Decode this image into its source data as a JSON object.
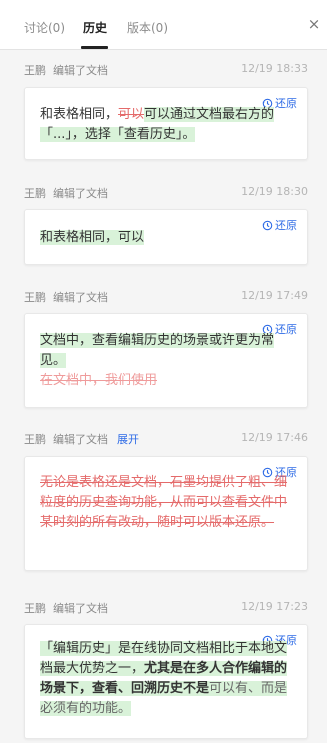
{
  "tabs": [
    {
      "label": "讨论(0)"
    },
    {
      "label": "历史"
    },
    {
      "label": "版本(0)"
    }
  ],
  "close_icon": "×",
  "restore_label": "还原",
  "entries": [
    {
      "author": "王鹏",
      "action": "编辑了文档",
      "time": "12/19 18:33",
      "segs": [
        "和表格相同，",
        "可以",
        "可以通过文档最右方的「...」，选择「查看历史」。"
      ]
    },
    {
      "author": "王鹏",
      "action": "编辑了文档",
      "time": "12/19 18:30",
      "segs": [
        "和表格相同，可以"
      ]
    },
    {
      "author": "王鹏",
      "action": "编辑了文档",
      "time": "12/19 17:49",
      "segs": [
        "文档中，查看编辑历史的场景或许更为常见。",
        "在文档中，我们使用"
      ]
    },
    {
      "author": "王鹏",
      "action": "编辑了文档",
      "expand": "展开",
      "time": "12/19 17:46",
      "segs": [
        "无论是表格还是文档，石墨均提供了粗、细粒度的历史查询功能，从而可以查看文件中某时刻的所有改动，随时可以版本还原。"
      ]
    },
    {
      "author": "王鹏",
      "action": "编辑了文档",
      "time": "12/19 17:23",
      "segs": [
        "「编辑历史」是在线协同文档相比于本地文档最大优势之一，",
        "尤其是在多人合作编辑的场景下，查看、回溯历史不是",
        "可以有、而是必须有的功能。"
      ]
    }
  ]
}
